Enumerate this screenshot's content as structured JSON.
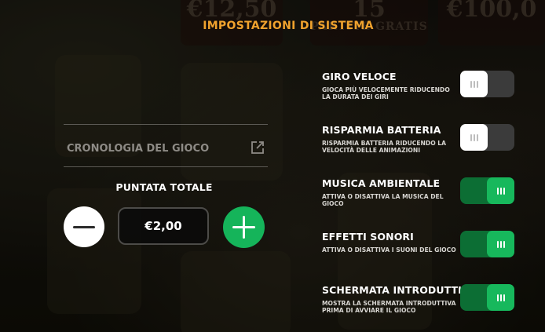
{
  "background": {
    "prizes": [
      "€12,50",
      "15",
      "€100,0"
    ],
    "prize_caption": "PARTITE GRATIS"
  },
  "title": "IMPOSTAZIONI DI SISTEMA",
  "history": {
    "label": "CRONOLOGIA DEL GIOCO",
    "icon": "external-link-icon"
  },
  "bet": {
    "label": "PUNTATA TOTALE",
    "value": "€2,00"
  },
  "settings": [
    {
      "name": "GIRO VELOCE",
      "desc": "GIOCA PIÙ VELOCEMENTE RIDUCENDO LA DURATA DEI GIRI",
      "enabled": false
    },
    {
      "name": "RISPARMIA BATTERIA",
      "desc": "RISPARMIA BATTERIA RIDUCENDO LA VELOCITÀ DELLE ANIMAZIONI",
      "enabled": false
    },
    {
      "name": "MUSICA AMBIENTALE",
      "desc": "ATTIVA O DISATTIVA LA MUSICA DEL GIOCO",
      "enabled": true
    },
    {
      "name": "EFFETTI SONORI",
      "desc": "ATTIVA O DISATTIVA I SUONI DEL GIOCO",
      "enabled": true
    },
    {
      "name": "SCHERMATA INTRODUTTIVA",
      "desc": "MOSTRA LA SCHERMATA INTRODUTTIVA PRIMA DI AVVIARE IL GIOCO",
      "enabled": true
    }
  ],
  "colors": {
    "title": "#f0a22d",
    "toggle_on_track": "#0c6e34",
    "toggle_on_knob": "#17b85c",
    "toggle_off_track": "#3b3b3b",
    "plus_button": "#15b45a"
  }
}
